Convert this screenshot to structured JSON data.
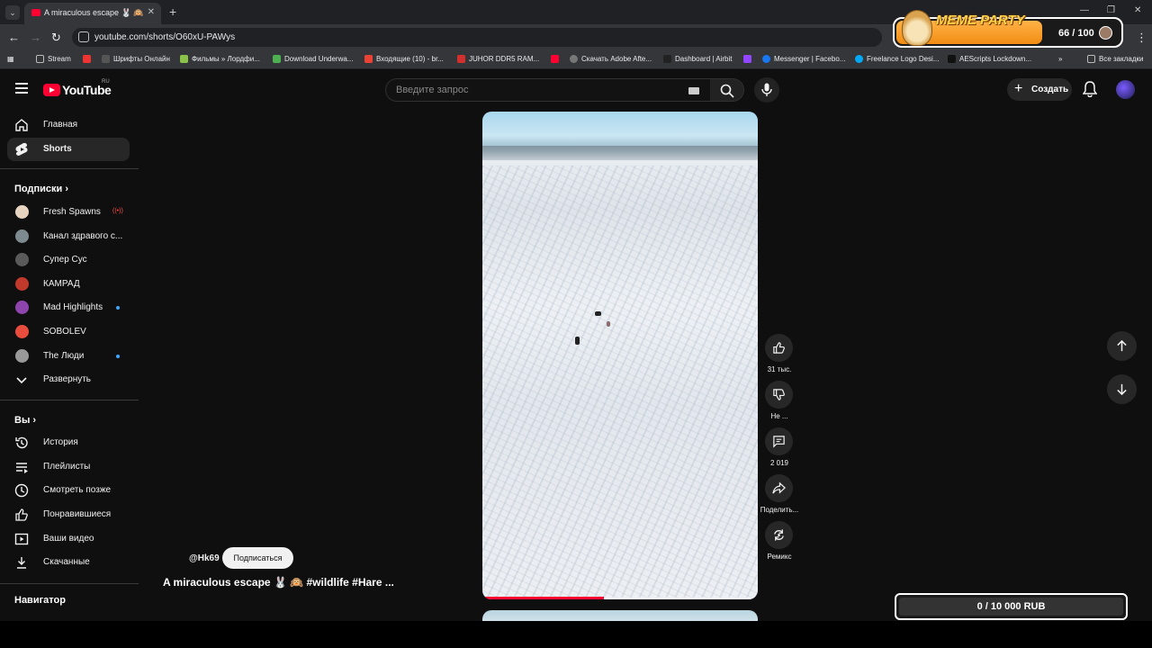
{
  "browser": {
    "tab_title": "A miraculous escape 🐰 🙉",
    "url": "youtube.com/shorts/O60xU-PAWys",
    "bookmarks": [
      "Stream",
      "",
      "Шрифты Онлайн",
      "Фильмы » Лордфи...",
      "Download Underwa...",
      "Входящие (10) - br...",
      "JUHOR DDR5 RAM...",
      "",
      "Скачать Adobe Afte...",
      "Dashboard | Airbit",
      "",
      "Messenger | Facebo...",
      "Freelance Logo Desi...",
      "AEScripts Lockdown...",
      "Все закладки"
    ]
  },
  "meme_party": {
    "brand": "MEME PARTY",
    "count": "66 / 100",
    "progress": 0.66
  },
  "youtube": {
    "logo_text": "YouTube",
    "country_code": "RU",
    "search_placeholder": "Введите запрос",
    "create_label": "Создать"
  },
  "sidebar": {
    "main": [
      {
        "label": "Главная",
        "icon": "home-icon"
      },
      {
        "label": "Shorts",
        "icon": "shorts-icon"
      }
    ],
    "subscriptions_heading": "Подписки",
    "subscriptions": [
      {
        "label": "Fresh Spawns",
        "avatar_color": "#e6d3c0",
        "badge": "live"
      },
      {
        "label": "Канал здравого с...",
        "avatar_color": "#7d8a8f"
      },
      {
        "label": "Супер Сус",
        "avatar_color": "#5a5a5a"
      },
      {
        "label": "КАМРАД",
        "avatar_color": "#c0392b"
      },
      {
        "label": "Mad Highlights",
        "avatar_color": "#8e44ad",
        "badge": "dot"
      },
      {
        "label": "SOBOLEV",
        "avatar_color": "#e74c3c"
      },
      {
        "label": "The Люди",
        "avatar_color": "#999999",
        "badge": "dot"
      }
    ],
    "expand_label": "Развернуть",
    "you_heading": "Вы",
    "you_items": [
      {
        "label": "История",
        "icon": "history-icon"
      },
      {
        "label": "Плейлисты",
        "icon": "playlists-icon"
      },
      {
        "label": "Смотреть позже",
        "icon": "watch-later-icon"
      },
      {
        "label": "Понравившиеся",
        "icon": "liked-icon"
      },
      {
        "label": "Ваши видео",
        "icon": "your-videos-icon"
      },
      {
        "label": "Скачанные",
        "icon": "downloads-icon"
      }
    ],
    "navigator_heading": "Навигатор"
  },
  "short": {
    "channel": "@Hk69",
    "subscribe_label": "Подписаться",
    "title": "A miraculous escape 🐰 🙉 #wildlife #Hare ...",
    "progress": 0.44,
    "actions": {
      "likes": "31 тыс.",
      "dislike": "Не ...",
      "comments": "2 019",
      "share": "Поделить...",
      "remix": "Ремикс"
    }
  },
  "donation": {
    "label": "0 / 10 000 RUB"
  }
}
